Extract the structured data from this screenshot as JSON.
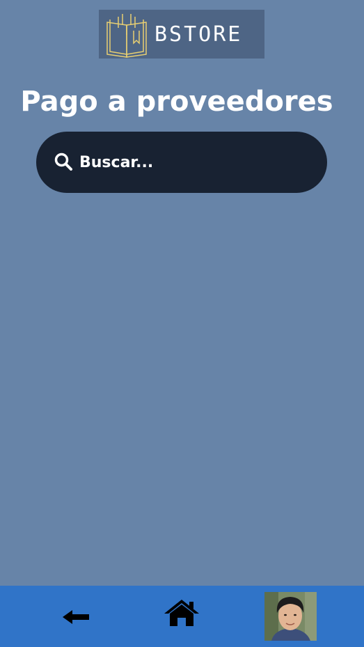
{
  "header": {
    "logo_text": "BSTORE",
    "title": "Pago a proveedores"
  },
  "search": {
    "placeholder": "Buscar...",
    "icon": "search-icon"
  },
  "bottom_nav": {
    "items": [
      {
        "icon": "arrow-left-icon"
      },
      {
        "icon": "home-icon"
      },
      {
        "icon": "user-avatar"
      }
    ]
  },
  "colors": {
    "background": "#6784a8",
    "search_bg": "#182232",
    "nav_bg": "#3074c8",
    "logo_bg": "#4e6585",
    "logo_accent": "#e8cf72"
  }
}
